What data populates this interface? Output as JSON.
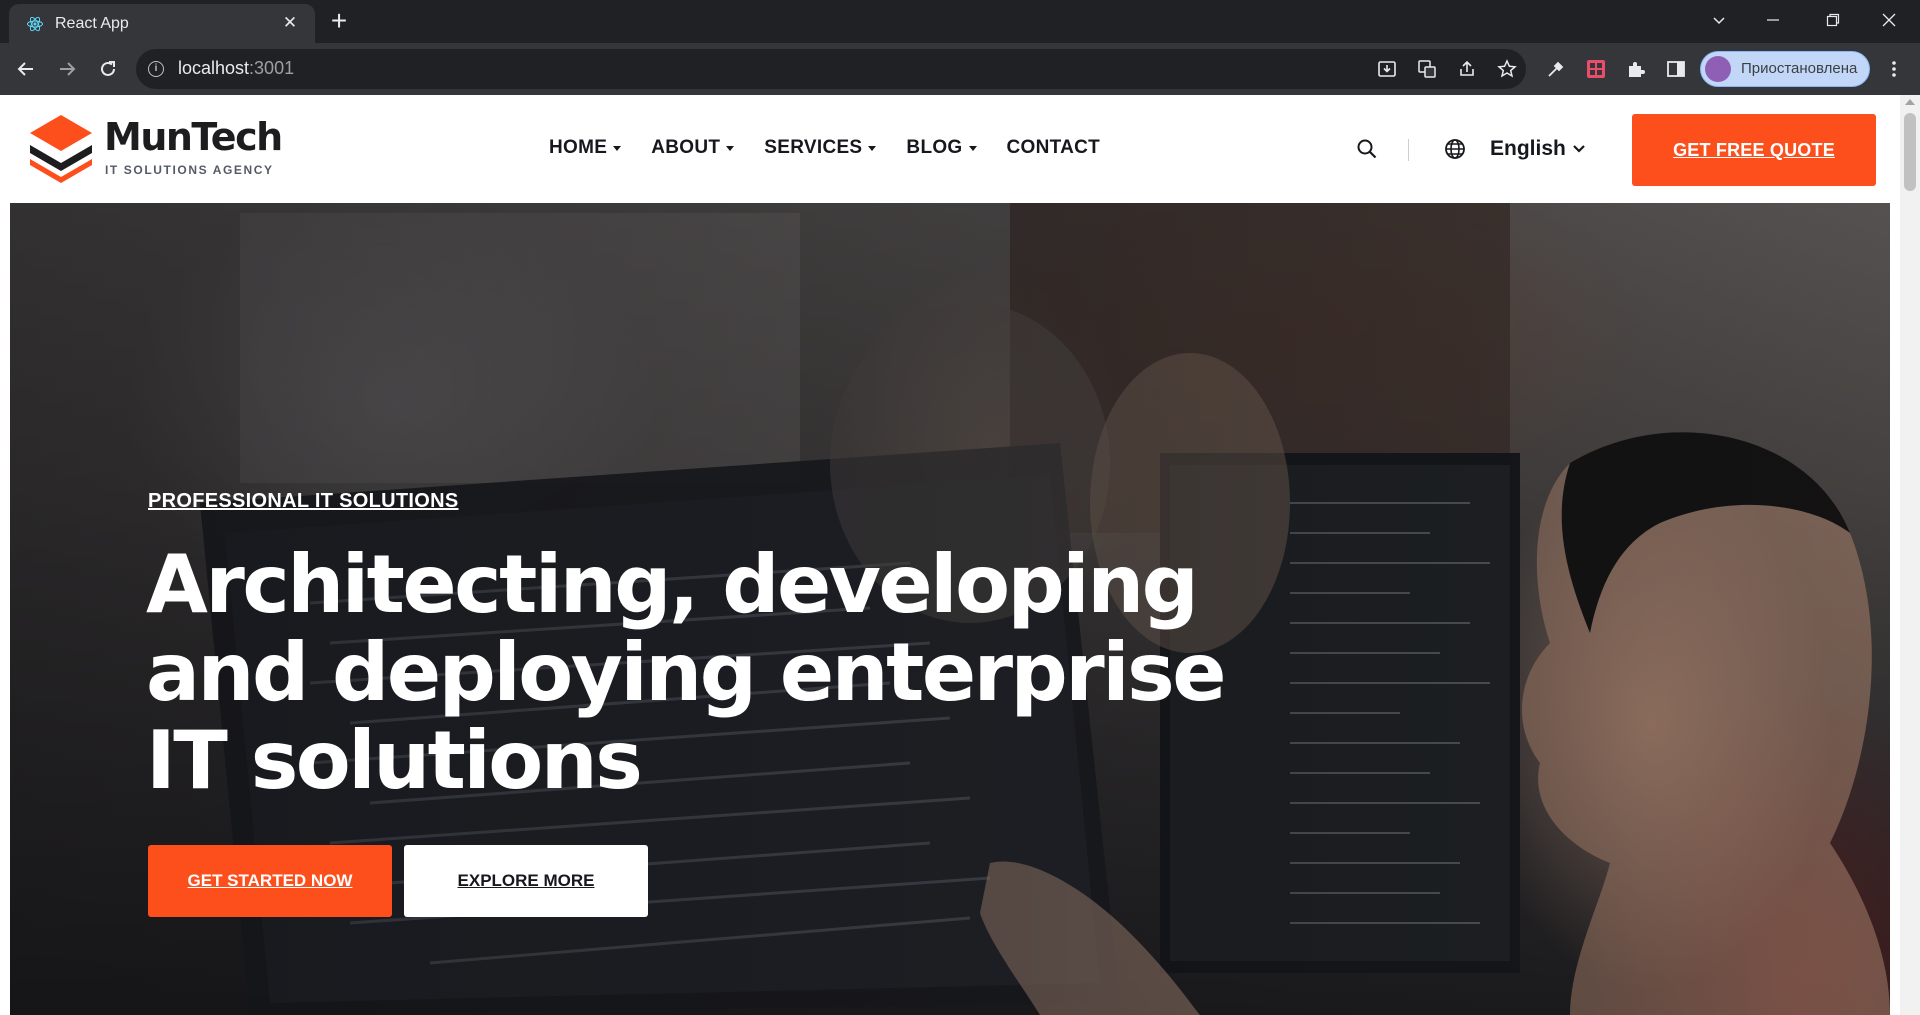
{
  "browser": {
    "tab_title": "React App",
    "tab_close": "✕",
    "new_tab": "+",
    "url_host": "localhost",
    "url_port": ":3001",
    "profile_label": "Приостановлена"
  },
  "header": {
    "logo_name": "MunTech",
    "logo_tagline": "IT SOLUTIONS AGENCY",
    "nav": [
      {
        "label": "HOME",
        "dropdown": true
      },
      {
        "label": "ABOUT",
        "dropdown": true
      },
      {
        "label": "SERVICES",
        "dropdown": true
      },
      {
        "label": "BLOG",
        "dropdown": true
      },
      {
        "label": "CONTACT",
        "dropdown": false
      }
    ],
    "language": "English",
    "cta_label": "GET FREE QUOTE"
  },
  "hero": {
    "eyebrow": "PROFESSIONAL IT SOLUTIONS",
    "title_lines": [
      "Architecting, developing",
      "and deploying enterprise",
      "IT solutions"
    ],
    "primary_button": "GET STARTED NOW",
    "secondary_button": "EXPLORE MORE"
  },
  "colors": {
    "accent": "#fc4f1c",
    "heading_dark": "#16181d",
    "chrome_dark": "#202124",
    "chrome_mid": "#35363a"
  },
  "icons": [
    "react-favicon-icon",
    "back-icon",
    "forward-icon",
    "reload-icon",
    "site-info-icon",
    "install-icon",
    "translate-icon",
    "share-icon",
    "bookmark-star-icon",
    "eyedropper-icon",
    "extension-grid-icon",
    "puzzle-icon",
    "side-panel-icon",
    "search-icon",
    "globe-icon",
    "chevron-down-icon"
  ]
}
